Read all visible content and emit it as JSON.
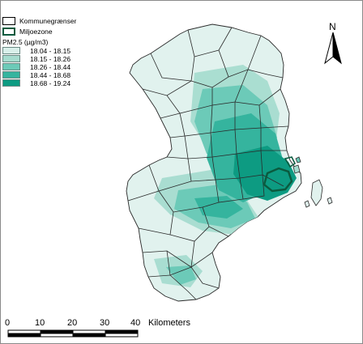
{
  "legend": {
    "boundaries_label": "Kommunegrænser",
    "zone_label": "Miljoezone",
    "title": "PM2.5 (µg/m3)",
    "classes": [
      {
        "label": "18.04 - 18.15",
        "color": "#d9efea"
      },
      {
        "label": "18.15 - 18.26",
        "color": "#a6dccf"
      },
      {
        "label": "18.26 - 18.44",
        "color": "#6ccab8"
      },
      {
        "label": "18.44 - 18.68",
        "color": "#35b49e"
      },
      {
        "label": "18.68 - 19.24",
        "color": "#0d9b82"
      }
    ]
  },
  "north_arrow": {
    "label": "N"
  },
  "scale": {
    "ticks": [
      "0",
      "10",
      "20",
      "30",
      "40"
    ],
    "unit": "Kilometers"
  },
  "colors": {
    "base_land": "#e1f2ee",
    "boundary": "#2a2a2a",
    "zone_outline": "#0a5a3e"
  }
}
